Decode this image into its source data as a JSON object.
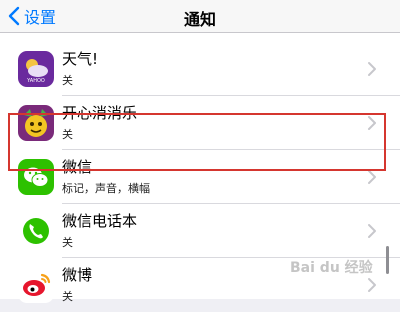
{
  "nav": {
    "back_label": "设置",
    "title": "通知"
  },
  "apps": [
    {
      "name": "天气!",
      "status": "关",
      "icon": "weather-app-icon"
    },
    {
      "name": "开心消消乐",
      "status": "关",
      "icon": "happy-match-game-icon"
    },
    {
      "name": "微信",
      "status": "标记，声音，横幅",
      "icon": "wechat-app-icon"
    },
    {
      "name": "微信电话本",
      "status": "关",
      "icon": "wechat-phonebook-icon"
    },
    {
      "name": "微博",
      "status": "关",
      "icon": "weibo-app-icon"
    }
  ],
  "highlighted_app": "微信",
  "colors": {
    "accent": "#007aff",
    "highlight_box": "#d5362f",
    "wechat_green": "#2dc100"
  },
  "watermark": "Bai du 经验"
}
